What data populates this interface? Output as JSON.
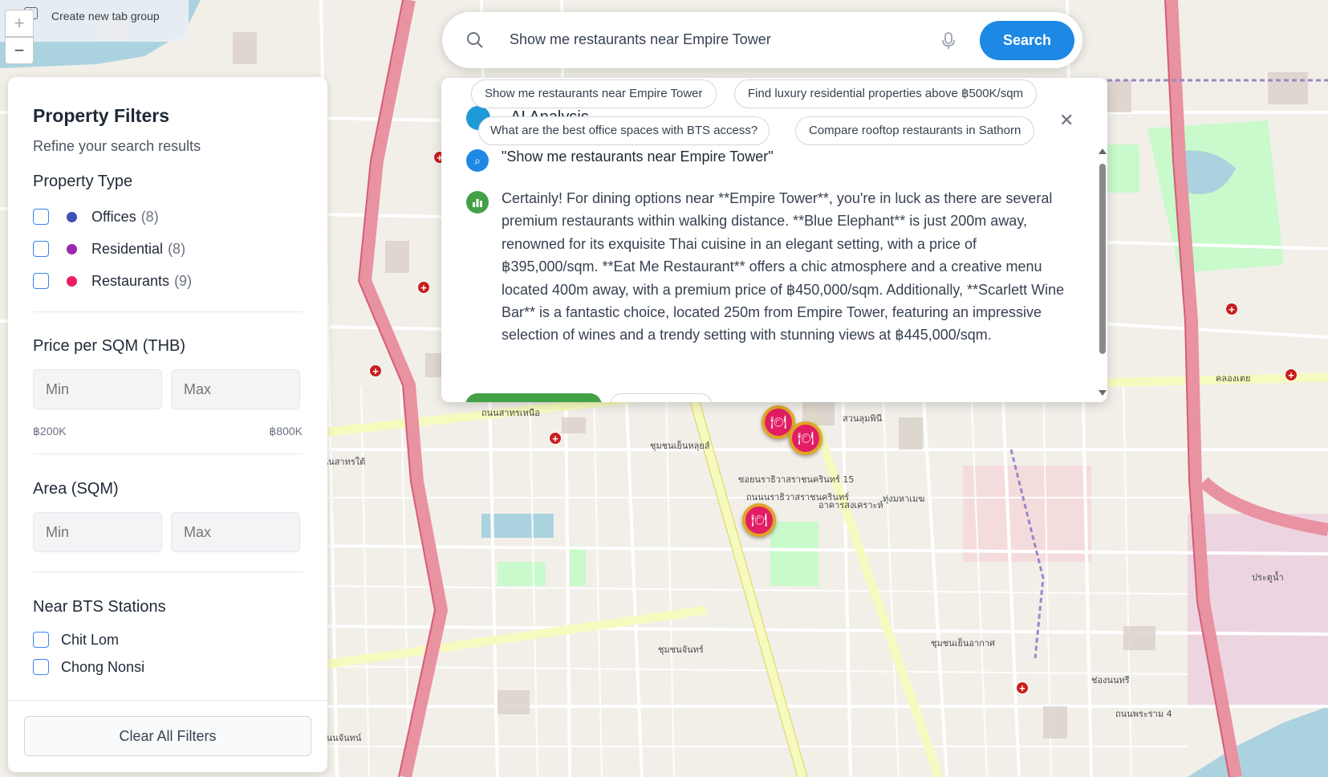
{
  "browser": {
    "tab_group_label": "Create new tab group",
    "zoom_in": "+",
    "zoom_out": "−"
  },
  "sidebar": {
    "title": "Property Filters",
    "subtitle": "Refine your search results",
    "property_type": {
      "heading": "Property Type",
      "items": [
        {
          "label": "Offices",
          "count": "(8)",
          "color": "#3f51b5"
        },
        {
          "label": "Residential",
          "count": "(8)",
          "color": "#9c27b0"
        },
        {
          "label": "Restaurants",
          "count": "(9)",
          "color": "#e91e63"
        }
      ]
    },
    "price": {
      "heading": "Price per SQM (THB)",
      "min_placeholder": "Min",
      "max_placeholder": "Max",
      "min_label": "฿200K",
      "max_label": "฿800K"
    },
    "area": {
      "heading": "Area (SQM)",
      "min_placeholder": "Min",
      "max_placeholder": "Max"
    },
    "bts": {
      "heading": "Near BTS Stations",
      "items": [
        "Chit Lom",
        "Chong Nonsi"
      ]
    },
    "clear_button": "Clear All Filters"
  },
  "search": {
    "query": "Show me restaurants near Empire Tower",
    "button": "Search"
  },
  "ai_panel": {
    "title": "AI Analysis",
    "suggestions": [
      "Show me restaurants near Empire Tower",
      "Find luxury residential properties above ฿500K/sqm",
      "What are the best office spaces with BTS access?",
      "Compare rooftop restaurants in Sathorn"
    ],
    "user_query": "\"Show me restaurants near Empire Tower\"",
    "answer": "Certainly! For dining options near **Empire Tower**, you're in luck as there are several premium restaurants within walking distance. **Blue Elephant** is just 200m away, renowned for its exquisite Thai cuisine in an elegant setting, with a price of ฿395,000/sqm. **Eat Me Restaurant** offers a chic atmosphere and a creative menu located 400m away, with a premium price of ฿450,000/sqm. Additionally, **Scarlett Wine Bar** is a fantastic choice, located 250m from Empire Tower, featuring an impressive selection of wines and a trendy setting with stunning views at ฿445,000/sqm."
  },
  "map_labels": [
    "ถนนสาทรใต้",
    "ถนนสาทรเหนือ",
    "ถนนนราธิวาสราชนครินทร์",
    "อาคารสงเคราะห์",
    "ทุ่งมหาเมฆ",
    "ชุมชนเย็นอากาศ",
    "ชุมชนจันทร์",
    "ประตูน้ำ",
    "ถนนจันทน์",
    "ถนนพระราม 4",
    "ชุมชนเย็นหลุยส์",
    "ซอยนราธิวาสราชนครินทร์ 15",
    "สวนลุมพินี",
    "คลองเตย",
    "ช่องนนทรี"
  ]
}
